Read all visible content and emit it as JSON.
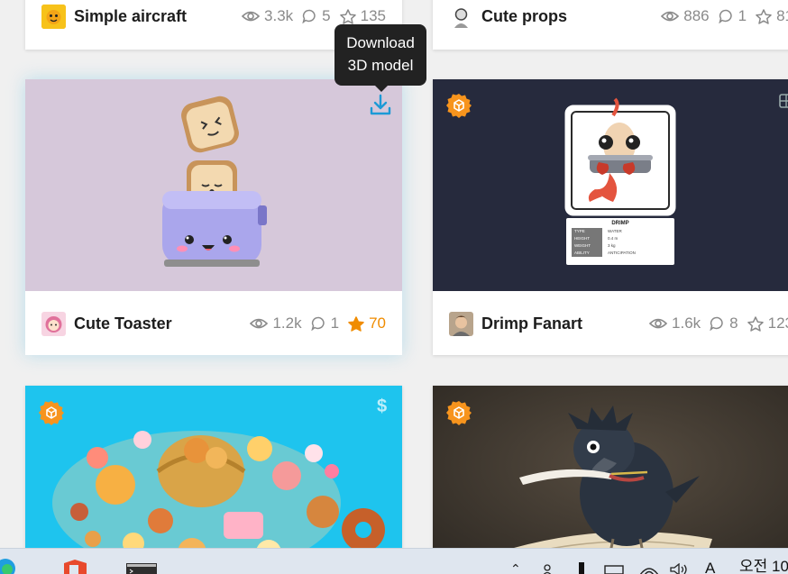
{
  "cards": {
    "aircraft": {
      "title": "Simple aircraft",
      "views": "3.3k",
      "comments": "5",
      "likes": "135"
    },
    "props": {
      "title": "Cute props",
      "views": "886",
      "comments": "1",
      "likes": "81"
    },
    "toaster": {
      "title": "Cute Toaster",
      "views": "1.2k",
      "comments": "1",
      "likes": "70"
    },
    "drimp": {
      "title": "Drimp Fanart",
      "views": "1.6k",
      "comments": "8",
      "likes": "123"
    }
  },
  "drimp_card": {
    "name": "DRIMP",
    "rows": [
      {
        "key": "TYPE",
        "value": "WATER"
      },
      {
        "key": "HEIGHT",
        "value": "0.4 m"
      },
      {
        "key": "WEIGHT",
        "value": "3 kg"
      },
      {
        "key": "ABILITY",
        "value": "ANTICIPATION"
      }
    ]
  },
  "tooltip": {
    "line1": "Download",
    "line2": "3D model"
  },
  "price_symbol": "$",
  "taskbar": {
    "clock": "오전 10"
  },
  "colors": {
    "staff_pick": "#f7941d",
    "liked": "#f08c00",
    "download": "#1c9ad6"
  },
  "icons": [
    "eye-icon",
    "comment-icon",
    "star-icon",
    "download-icon",
    "staff-pick-icon",
    "price-icon",
    "gallery-icon"
  ]
}
